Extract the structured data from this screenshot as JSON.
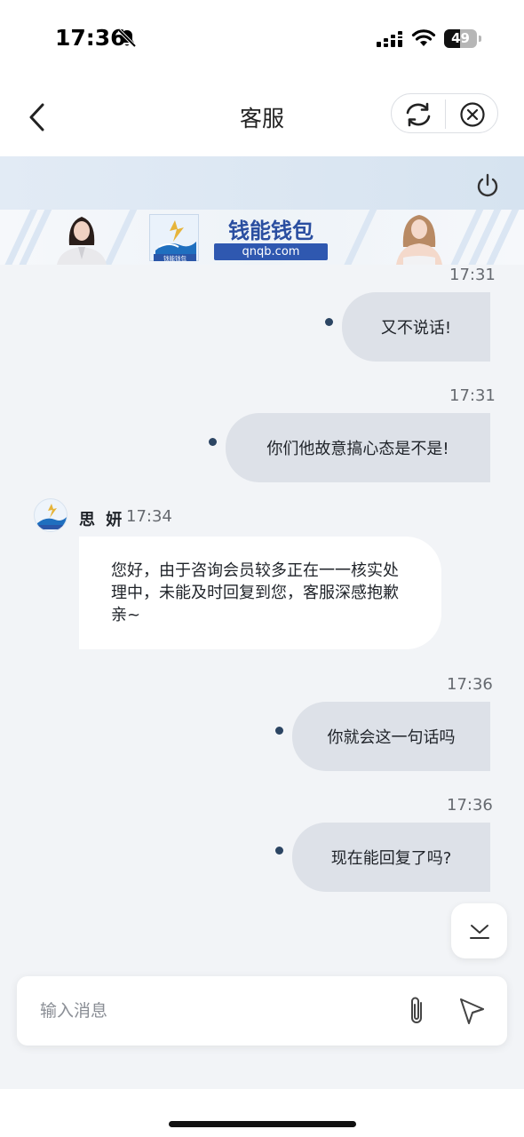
{
  "status_bar": {
    "time": "17:36",
    "battery": "49",
    "battery_level": 0.49
  },
  "header": {
    "title": "客服"
  },
  "banner": {
    "brand": "钱能钱包",
    "url": "qnqb.com",
    "logo_text": "钱能钱包"
  },
  "messages": [
    {
      "side": "out",
      "time": "17:31",
      "text": "又不说话!"
    },
    {
      "side": "out",
      "time": "17:31",
      "text": "你们他故意搞心态是不是!"
    },
    {
      "side": "in",
      "name": "思 妍",
      "time": "17:34",
      "text": "您好，由于咨询会员较多正在一一核实处理中，未能及时回复到您，客服深感抱歉亲~"
    },
    {
      "side": "out",
      "time": "17:36",
      "text": "你就会这一句话吗"
    },
    {
      "side": "out",
      "time": "17:36",
      "text": "现在能回复了吗?"
    }
  ],
  "input": {
    "placeholder": "输入消息"
  },
  "colors": {
    "chat_bg": "#f2f4f7",
    "bubble_out": "#dde1e8",
    "bubble_in": "#ffffff",
    "dot": "#2c4563",
    "brand_blue": "#2f58b0"
  },
  "icons": [
    "bell-off-icon",
    "signal-icon",
    "wifi-icon",
    "battery-icon",
    "back-arrow-icon",
    "refresh-icon",
    "close-circle-icon",
    "power-icon",
    "chevron-down-icon",
    "paperclip-icon",
    "send-icon"
  ]
}
